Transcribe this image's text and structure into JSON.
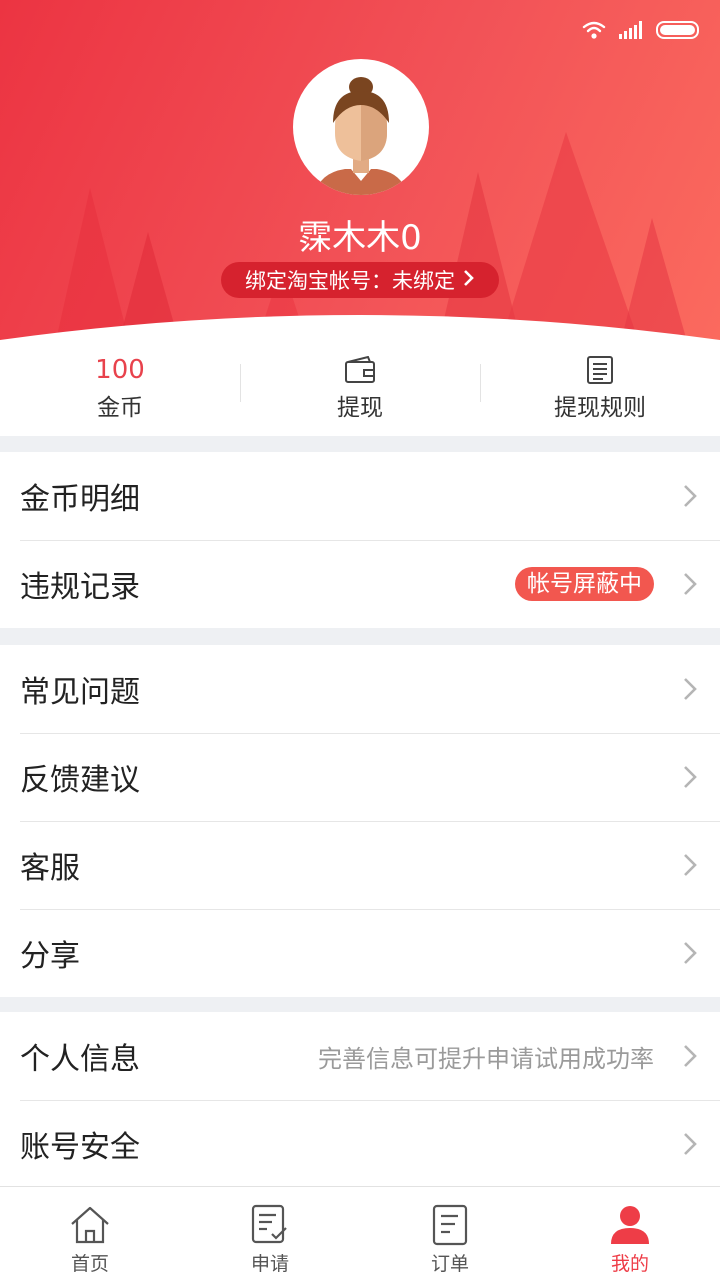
{
  "profile": {
    "username": "霂木木0",
    "bind_label": "绑定淘宝帐号：未绑定"
  },
  "stats": [
    {
      "value": "100",
      "label": "金币"
    },
    {
      "icon": "wallet-icon",
      "label": "提现"
    },
    {
      "icon": "document-list-icon",
      "label": "提现规则"
    }
  ],
  "menu": {
    "group1": [
      {
        "label": "金币明细"
      },
      {
        "label": "违规记录",
        "badge": "帐号屏蔽中"
      }
    ],
    "group2": [
      {
        "label": "常见问题"
      },
      {
        "label": "反馈建议"
      },
      {
        "label": "客服"
      },
      {
        "label": "分享"
      }
    ],
    "group3": [
      {
        "label": "个人信息",
        "hint": "完善信息可提升申请试用成功率"
      },
      {
        "label": "账号安全"
      }
    ]
  },
  "nav": [
    {
      "label": "首页",
      "icon": "home-icon"
    },
    {
      "label": "申请",
      "icon": "apply-icon"
    },
    {
      "label": "订单",
      "icon": "order-icon"
    },
    {
      "label": "我的",
      "icon": "person-icon",
      "active": true
    }
  ],
  "colors": {
    "accent": "#ee3d47",
    "badge": "#f2574f",
    "header_start": "#ec3442",
    "header_end": "#fb6a5e"
  }
}
